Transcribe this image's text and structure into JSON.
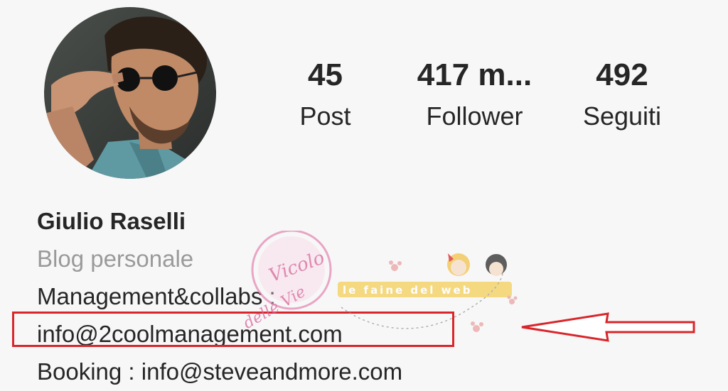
{
  "profile": {
    "stats": {
      "posts": {
        "value": "45",
        "label": "Post"
      },
      "followers": {
        "value": "417 m...",
        "label": "Follower"
      },
      "following": {
        "value": "492",
        "label": "Seguiti"
      }
    },
    "name": "Giulio Raselli",
    "category": "Blog personale",
    "bio_lines": [
      "Management&collabs :",
      "info@2coolmanagement.com",
      "Booking : info@steveandmore.com"
    ]
  },
  "annotation": {
    "highlight_color": "#d8262b"
  },
  "watermark": {
    "badge_text": "Vicolo delle Vie",
    "banner_text": "le faine del web"
  }
}
